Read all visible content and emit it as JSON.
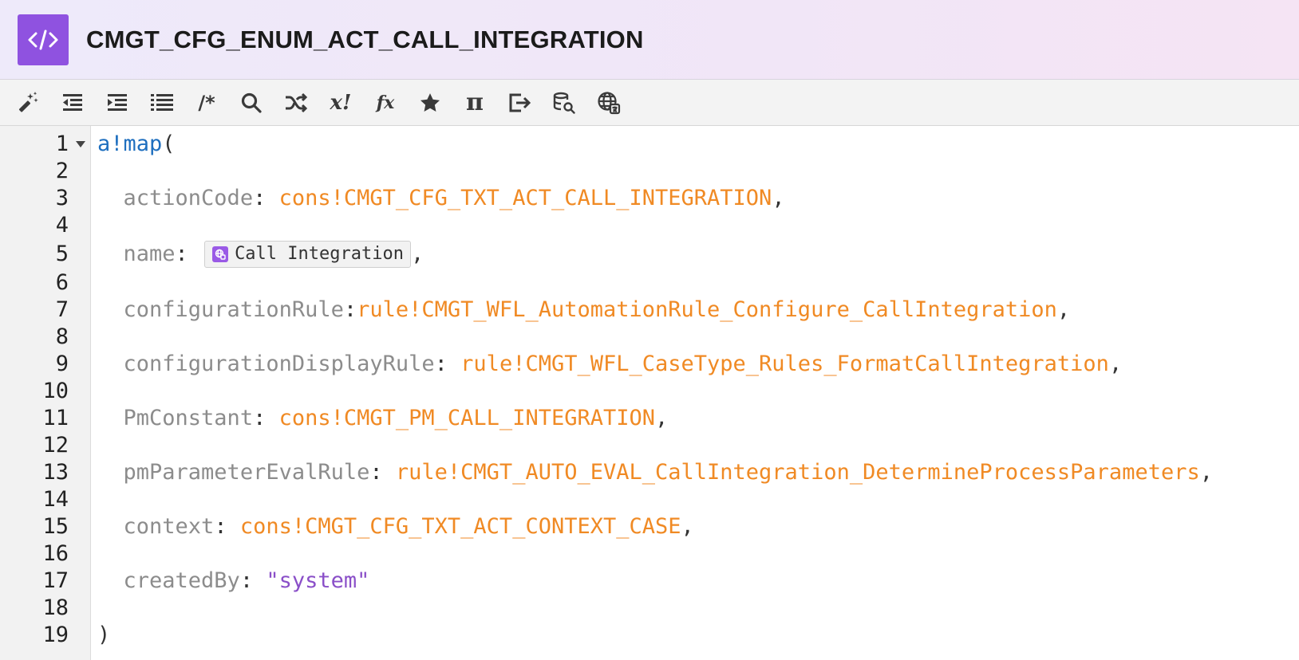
{
  "header": {
    "title": "CMGT_CFG_ENUM_ACT_CALL_INTEGRATION",
    "logo_glyph": "</>",
    "logo_color": "#8f52e0"
  },
  "toolbar": {
    "buttons": [
      {
        "name": "magic-wand-icon"
      },
      {
        "name": "outdent-icon"
      },
      {
        "name": "indent-icon"
      },
      {
        "name": "list-icon"
      },
      {
        "name": "comment-icon",
        "label": "/*"
      },
      {
        "name": "search-icon"
      },
      {
        "name": "shuffle-icon"
      },
      {
        "name": "variable-icon",
        "label": "x!"
      },
      {
        "name": "function-icon",
        "label": "fx"
      },
      {
        "name": "star-icon"
      },
      {
        "name": "pi-icon",
        "label": "π"
      },
      {
        "name": "export-icon"
      },
      {
        "name": "database-search-icon"
      },
      {
        "name": "translation-globe-icon"
      }
    ]
  },
  "editor": {
    "line_numbers": [
      "1",
      "2",
      "3",
      "4",
      "5",
      "6",
      "7",
      "8",
      "9",
      "10",
      "11",
      "12",
      "13",
      "14",
      "15",
      "16",
      "17",
      "18",
      "19"
    ],
    "lines": {
      "l1": {
        "fn": "a!map",
        "open": "("
      },
      "l3": {
        "key": "actionCode",
        "sep": ": ",
        "val": "cons!CMGT_CFG_TXT_ACT_CALL_INTEGRATION",
        "end": ","
      },
      "l5": {
        "key": "name",
        "sep": ": ",
        "chip_text": "Call Integration",
        "end": ","
      },
      "l7": {
        "key": "configurationRule",
        "sep": ":",
        "val": "rule!CMGT_WFL_AutomationRule_Configure_CallIntegration",
        "end": ","
      },
      "l9": {
        "key": "configurationDisplayRule",
        "sep": ": ",
        "val": "rule!CMGT_WFL_CaseType_Rules_FormatCallIntegration",
        "end": ","
      },
      "l11": {
        "key": "PmConstant",
        "sep": ": ",
        "val": "cons!CMGT_PM_CALL_INTEGRATION",
        "end": ","
      },
      "l13": {
        "key": "pmParameterEvalRule",
        "sep": ": ",
        "val": "rule!CMGT_AUTO_EVAL_CallIntegration_DetermineProcessParameters",
        "end": ","
      },
      "l15": {
        "key": "context",
        "sep": ": ",
        "val": "cons!CMGT_CFG_TXT_ACT_CONTEXT_CASE",
        "end": ","
      },
      "l17": {
        "key": "createdBy",
        "sep": ": ",
        "str": "\"system\""
      },
      "l19": {
        "close": ")"
      }
    }
  },
  "colors": {
    "keyword": "#1f6fbf",
    "param_key": "#8c8c8c",
    "reference": "#f08a24",
    "string": "#8a4fc8"
  }
}
